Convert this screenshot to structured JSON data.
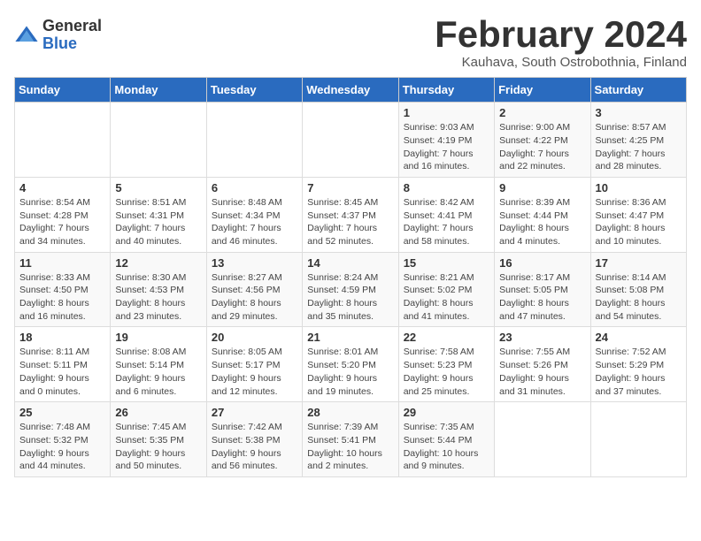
{
  "logo": {
    "general": "General",
    "blue": "Blue"
  },
  "title": "February 2024",
  "location": "Kauhava, South Ostrobothnia, Finland",
  "headers": [
    "Sunday",
    "Monday",
    "Tuesday",
    "Wednesday",
    "Thursday",
    "Friday",
    "Saturday"
  ],
  "weeks": [
    [
      {
        "day": "",
        "info": ""
      },
      {
        "day": "",
        "info": ""
      },
      {
        "day": "",
        "info": ""
      },
      {
        "day": "",
        "info": ""
      },
      {
        "day": "1",
        "sunrise": "9:03 AM",
        "sunset": "4:19 PM",
        "daylight": "7 hours and 16 minutes."
      },
      {
        "day": "2",
        "sunrise": "9:00 AM",
        "sunset": "4:22 PM",
        "daylight": "7 hours and 22 minutes."
      },
      {
        "day": "3",
        "sunrise": "8:57 AM",
        "sunset": "4:25 PM",
        "daylight": "7 hours and 28 minutes."
      }
    ],
    [
      {
        "day": "4",
        "sunrise": "8:54 AM",
        "sunset": "4:28 PM",
        "daylight": "7 hours and 34 minutes."
      },
      {
        "day": "5",
        "sunrise": "8:51 AM",
        "sunset": "4:31 PM",
        "daylight": "7 hours and 40 minutes."
      },
      {
        "day": "6",
        "sunrise": "8:48 AM",
        "sunset": "4:34 PM",
        "daylight": "7 hours and 46 minutes."
      },
      {
        "day": "7",
        "sunrise": "8:45 AM",
        "sunset": "4:37 PM",
        "daylight": "7 hours and 52 minutes."
      },
      {
        "day": "8",
        "sunrise": "8:42 AM",
        "sunset": "4:41 PM",
        "daylight": "7 hours and 58 minutes."
      },
      {
        "day": "9",
        "sunrise": "8:39 AM",
        "sunset": "4:44 PM",
        "daylight": "8 hours and 4 minutes."
      },
      {
        "day": "10",
        "sunrise": "8:36 AM",
        "sunset": "4:47 PM",
        "daylight": "8 hours and 10 minutes."
      }
    ],
    [
      {
        "day": "11",
        "sunrise": "8:33 AM",
        "sunset": "4:50 PM",
        "daylight": "8 hours and 16 minutes."
      },
      {
        "day": "12",
        "sunrise": "8:30 AM",
        "sunset": "4:53 PM",
        "daylight": "8 hours and 23 minutes."
      },
      {
        "day": "13",
        "sunrise": "8:27 AM",
        "sunset": "4:56 PM",
        "daylight": "8 hours and 29 minutes."
      },
      {
        "day": "14",
        "sunrise": "8:24 AM",
        "sunset": "4:59 PM",
        "daylight": "8 hours and 35 minutes."
      },
      {
        "day": "15",
        "sunrise": "8:21 AM",
        "sunset": "5:02 PM",
        "daylight": "8 hours and 41 minutes."
      },
      {
        "day": "16",
        "sunrise": "8:17 AM",
        "sunset": "5:05 PM",
        "daylight": "8 hours and 47 minutes."
      },
      {
        "day": "17",
        "sunrise": "8:14 AM",
        "sunset": "5:08 PM",
        "daylight": "8 hours and 54 minutes."
      }
    ],
    [
      {
        "day": "18",
        "sunrise": "8:11 AM",
        "sunset": "5:11 PM",
        "daylight": "9 hours and 0 minutes."
      },
      {
        "day": "19",
        "sunrise": "8:08 AM",
        "sunset": "5:14 PM",
        "daylight": "9 hours and 6 minutes."
      },
      {
        "day": "20",
        "sunrise": "8:05 AM",
        "sunset": "5:17 PM",
        "daylight": "9 hours and 12 minutes."
      },
      {
        "day": "21",
        "sunrise": "8:01 AM",
        "sunset": "5:20 PM",
        "daylight": "9 hours and 19 minutes."
      },
      {
        "day": "22",
        "sunrise": "7:58 AM",
        "sunset": "5:23 PM",
        "daylight": "9 hours and 25 minutes."
      },
      {
        "day": "23",
        "sunrise": "7:55 AM",
        "sunset": "5:26 PM",
        "daylight": "9 hours and 31 minutes."
      },
      {
        "day": "24",
        "sunrise": "7:52 AM",
        "sunset": "5:29 PM",
        "daylight": "9 hours and 37 minutes."
      }
    ],
    [
      {
        "day": "25",
        "sunrise": "7:48 AM",
        "sunset": "5:32 PM",
        "daylight": "9 hours and 44 minutes."
      },
      {
        "day": "26",
        "sunrise": "7:45 AM",
        "sunset": "5:35 PM",
        "daylight": "9 hours and 50 minutes."
      },
      {
        "day": "27",
        "sunrise": "7:42 AM",
        "sunset": "5:38 PM",
        "daylight": "9 hours and 56 minutes."
      },
      {
        "day": "28",
        "sunrise": "7:39 AM",
        "sunset": "5:41 PM",
        "daylight": "10 hours and 2 minutes."
      },
      {
        "day": "29",
        "sunrise": "7:35 AM",
        "sunset": "5:44 PM",
        "daylight": "10 hours and 9 minutes."
      },
      {
        "day": "",
        "info": ""
      },
      {
        "day": "",
        "info": ""
      }
    ]
  ],
  "labels": {
    "sunrise": "Sunrise: ",
    "sunset": "Sunset: ",
    "daylight": "Daylight: "
  }
}
